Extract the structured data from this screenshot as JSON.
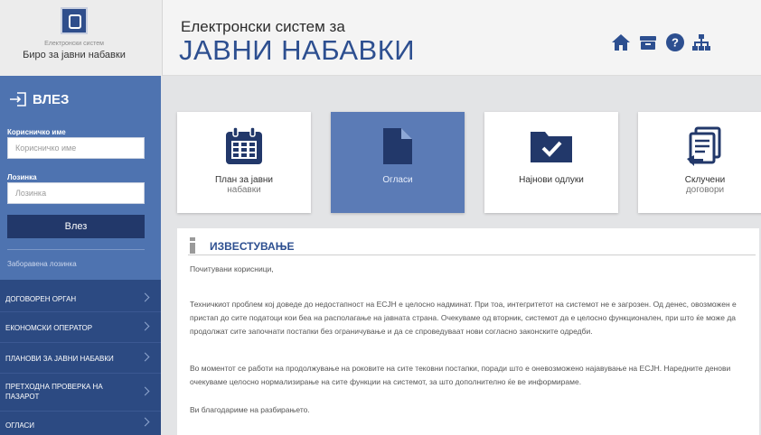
{
  "brand": {
    "small_text": "Електронски систем",
    "name": "Биро за јавни набавки"
  },
  "header": {
    "title_small": "Електронски систем за",
    "title_big": "ЈАВНИ НАБАВКИ",
    "icons": [
      "home-icon",
      "inbox-icon",
      "help-icon",
      "sitemap-icon"
    ],
    "accent": "#2d4f90"
  },
  "login": {
    "title": "ВЛЕЗ",
    "username_label": "Корисничко име",
    "username_placeholder": "Корисничко име",
    "password_label": "Лозинка",
    "password_placeholder": "Лозинка",
    "button": "Влез",
    "forgot": "Заборавена лозинка"
  },
  "nav": [
    "ДОГОВОРЕН ОРГАН",
    "ЕКОНОМСКИ ОПЕРАТОР",
    "ПЛАНОВИ ЗА ЈАВНИ НАБАВКИ",
    "ПРЕТХОДНА ПРОВЕРКА НА ПАЗАРОТ",
    "ОГЛАСИ"
  ],
  "tiles": [
    {
      "line1": "План за јавни",
      "line2": "набавки",
      "icon": "calendar-icon"
    },
    {
      "line1": "Огласи",
      "line2": "",
      "icon": "document-icon",
      "active": true
    },
    {
      "line1": "Најнови одлуки",
      "line2": "",
      "icon": "folder-check-icon"
    },
    {
      "line1": "Склучени",
      "line2": "договори",
      "icon": "contracts-icon"
    }
  ],
  "notice": {
    "title": "ИЗВЕСТУВАЊЕ",
    "p1": "Почитувани корисници,",
    "p2": "Техничкиот проблем кој доведе до недостапност на ЕСЈН е целосно надминат. При тоа, интегритетот на системот не е загрозен. Од денес, овозможен е пристап до сите податоци кои беа на располагање на јавната страна. Очекуваме од вторник, системот да е целосно функционален, при што ќе може да продолжат сите започнати постапки без ограничување и да се спроведуваат нови согласно законските одредби.",
    "p3": "Во моментот се работи на продолжување на роковите на сите тековни постапки, поради што е оневозможено најавување на ЕСЈН. Наредните денови очекуваме целосно нормализирање на сите функции на системот, за што дополнително ќе ве информираме.",
    "p4": "Ви благодариме на разбирањето."
  }
}
